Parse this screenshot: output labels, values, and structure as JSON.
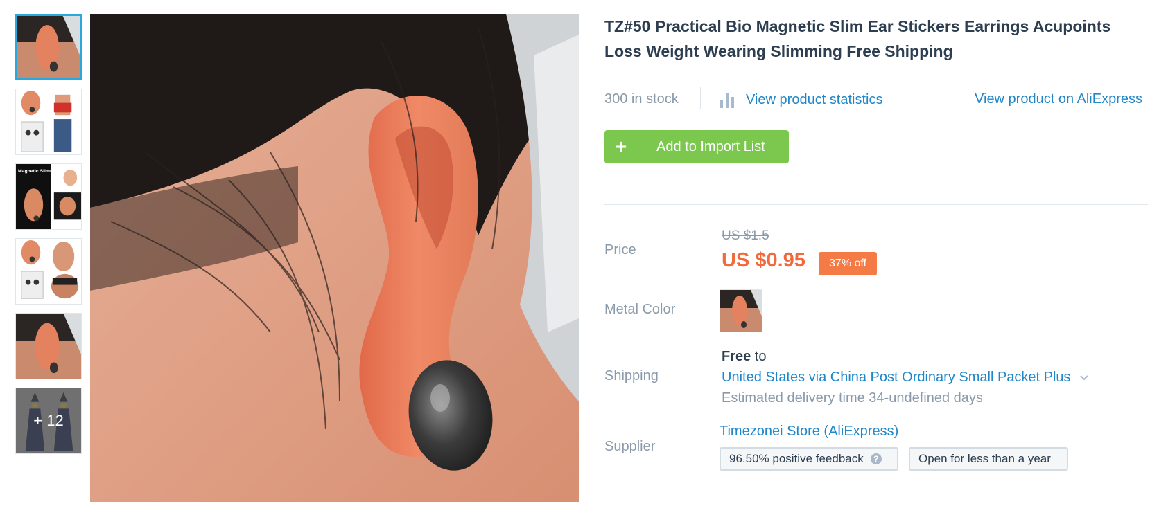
{
  "product": {
    "title": "TZ#50 Practical Bio Magnetic Slim Ear Stickers Earrings Acupoints Loss Weight Wearing Slimming Free Shipping",
    "stock": "300 in stock",
    "stats_link": "View product statistics",
    "aliexpress_link": "View product on AliExpress",
    "add_button": "Add to Import List",
    "add_icon": "+"
  },
  "gallery": {
    "thumbnails": [
      {
        "name": "thumb-ear-closeup",
        "active": true
      },
      {
        "name": "thumb-ear-and-body"
      },
      {
        "name": "thumb-magnetic-slimming"
      },
      {
        "name": "thumb-ear-and-hips"
      },
      {
        "name": "thumb-ear-magnet"
      },
      {
        "name": "thumb-more"
      }
    ],
    "more_count": "+ 12"
  },
  "pricing": {
    "label": "Price",
    "old_price": "US $1.5",
    "new_price": "US $0.95",
    "discount": "37% off"
  },
  "variant": {
    "label": "Metal Color"
  },
  "shipping": {
    "label": "Shipping",
    "free": "Free",
    "to": " to",
    "method": "United States via China Post Ordinary Small Packet Plus",
    "estimate": "Estimated delivery time 34-undefined days"
  },
  "supplier": {
    "label": "Supplier",
    "store": "Timezonei Store (AliExpress)",
    "feedback": "96.50% positive feedback",
    "feedback_help": "?",
    "open": "Open for less than a year"
  },
  "colors": {
    "link": "#1f87c9",
    "green": "#7cc84f",
    "price": "#f26a3c",
    "badge": "#f47b46",
    "active_thumb": "#29a8e0"
  }
}
